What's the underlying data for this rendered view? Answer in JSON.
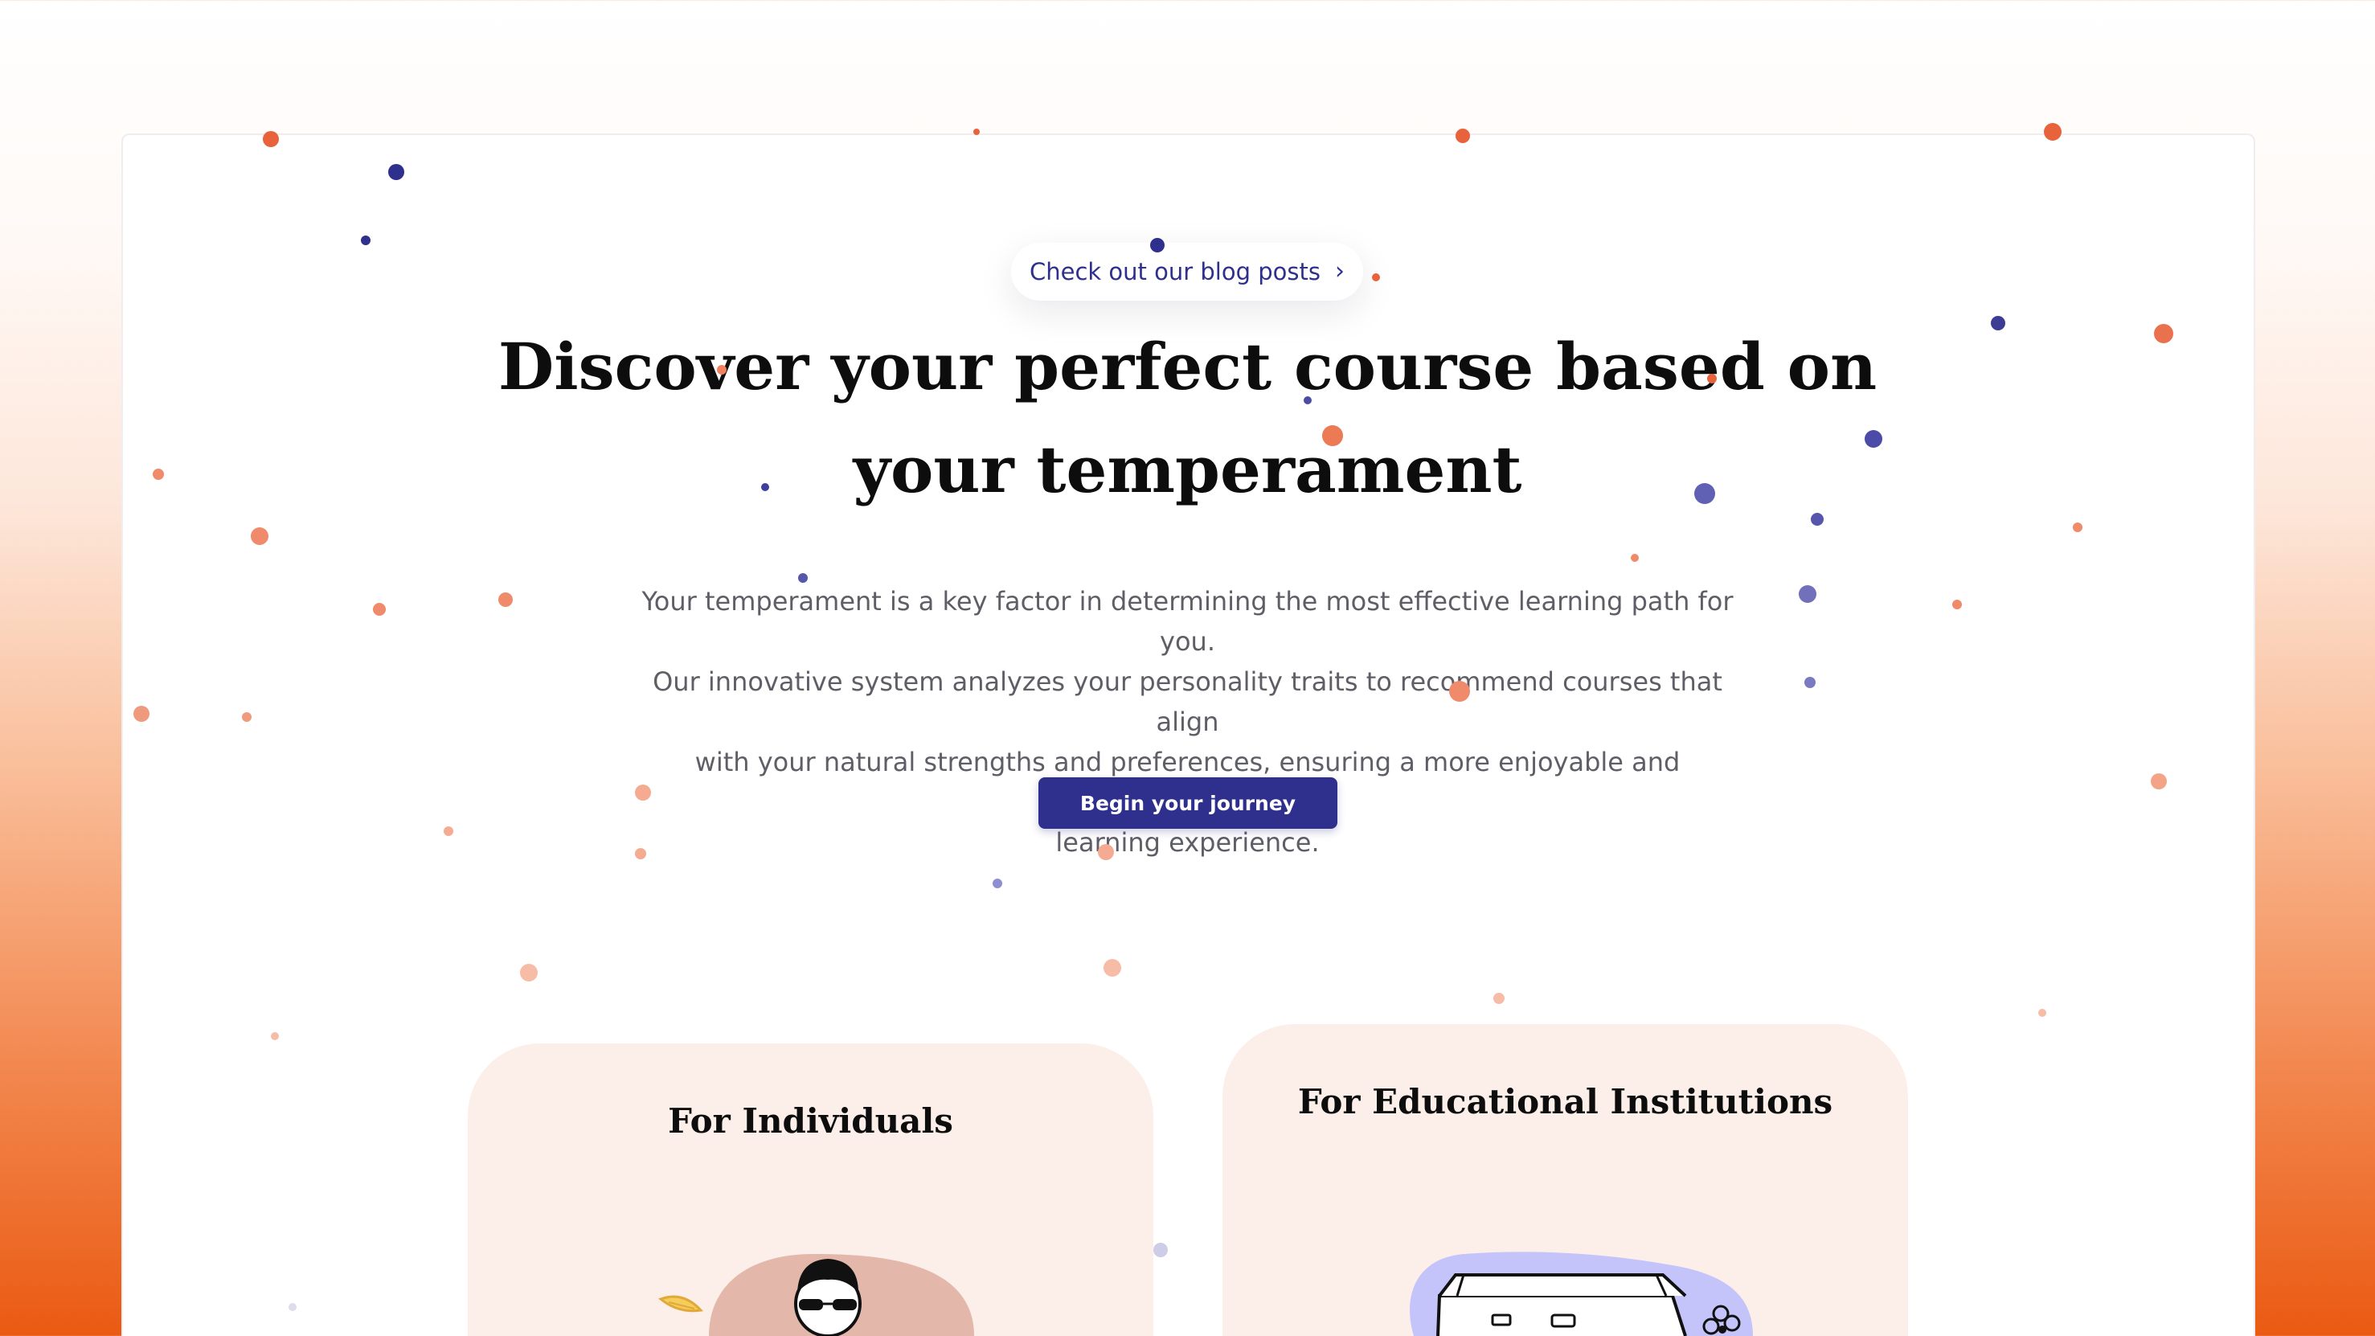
{
  "blog_pill": {
    "label": "Check out our blog posts",
    "chevron": "›",
    "icon": "chevron-right-icon"
  },
  "hero": {
    "title_line1": "Discover your perfect course based on",
    "title_line2": "your temperament",
    "description_lines": [
      "Your temperament is a key factor in determining the most effective learning path for you.",
      "Our innovative system analyzes your personality traits to recommend courses that align",
      "with your natural strengths and preferences, ensuring a more enjoyable and successful",
      "learning experience."
    ],
    "cta_label": "Begin your journey"
  },
  "cards": [
    {
      "title": "For Individuals",
      "illustration": "person-with-sunglasses-illustration"
    },
    {
      "title": "For Educational Institutions",
      "illustration": "school-building-illustration"
    }
  ],
  "colors": {
    "accent_navy": "#2f2f8d",
    "accent_orange": "#ea5a12",
    "card_bg": "#fcefe9",
    "text_dark": "#0d0d0d",
    "text_muted": "#5e5e66"
  }
}
